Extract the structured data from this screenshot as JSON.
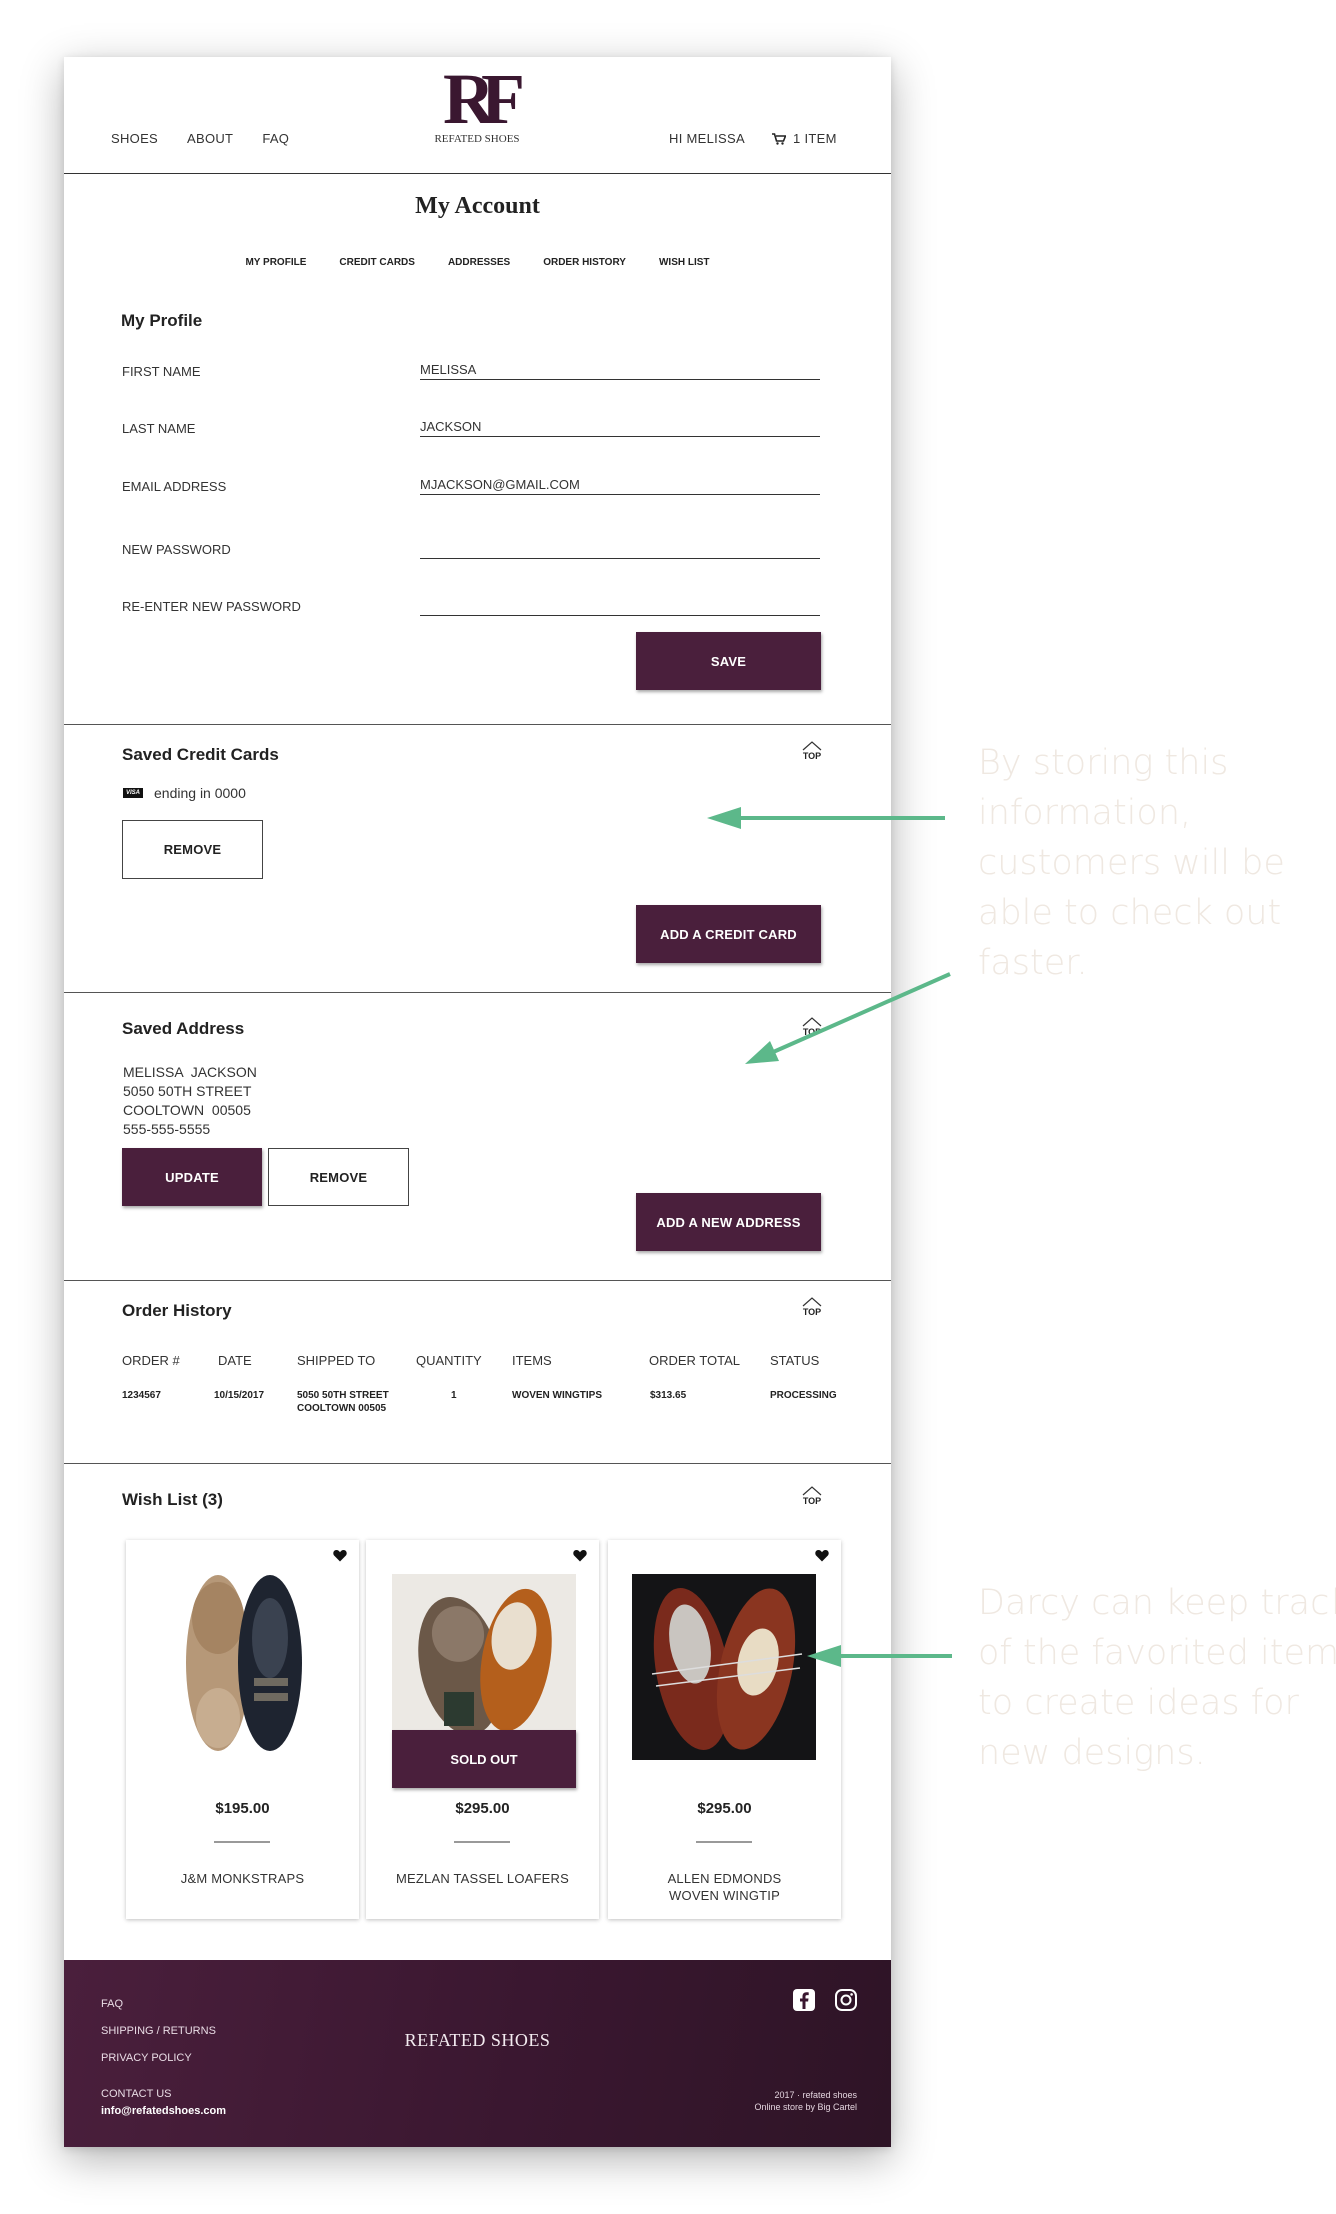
{
  "header": {
    "nav_left": [
      "SHOES",
      "ABOUT",
      "FAQ"
    ],
    "logo_mark": "RF",
    "logo_text": "REFATED SHOES",
    "greeting": "HI MELISSA",
    "cart_label": "1 ITEM"
  },
  "account": {
    "title": "My Account",
    "tabs": [
      "MY PROFILE",
      "CREDIT CARDS",
      "ADDRESSES",
      "ORDER HISTORY",
      "WISH LIST"
    ]
  },
  "profile": {
    "heading": "My Profile",
    "fields": [
      {
        "label": "FIRST NAME",
        "value": "MELISSA"
      },
      {
        "label": "LAST NAME",
        "value": "JACKSON"
      },
      {
        "label": "EMAIL ADDRESS",
        "value": "MJACKSON@GMAIL.COM"
      },
      {
        "label": "NEW PASSWORD",
        "value": ""
      },
      {
        "label": "RE-ENTER NEW PASSWORD",
        "value": ""
      }
    ],
    "save_label": "SAVE"
  },
  "top_label": "TOP",
  "cards": {
    "heading": "Saved Credit Cards",
    "card_brand": "VISA",
    "card_text": "ending in 0000",
    "remove_label": "REMOVE",
    "add_label": "ADD A CREDIT CARD"
  },
  "address": {
    "heading": "Saved Address",
    "lines": [
      "MELISSA  JACKSON",
      "5050 50TH STREET",
      "COOLTOWN  00505",
      "555-555-5555"
    ],
    "update_label": "UPDATE",
    "remove_label": "REMOVE",
    "add_label": "ADD A NEW ADDRESS"
  },
  "orders": {
    "heading": "Order History",
    "columns": [
      "ORDER #",
      "DATE",
      "SHIPPED TO",
      "QUANTITY",
      "ITEMS",
      "ORDER TOTAL",
      "STATUS"
    ],
    "rows": [
      {
        "order": "1234567",
        "date": "10/15/2017",
        "shipped_to": [
          "5050 50TH STREET",
          "COOLTOWN 00505"
        ],
        "quantity": "1",
        "items": "WOVEN WINGTIPS",
        "total": "$313.65",
        "status": "PROCESSING"
      }
    ]
  },
  "wishlist": {
    "heading": "Wish List (3)",
    "items": [
      {
        "price": "$195.00",
        "name": "J&M MONKSTRAPS",
        "sold_out": false
      },
      {
        "price": "$295.00",
        "name": "MEZLAN TASSEL LOAFERS",
        "sold_out": true,
        "sold_out_label": "SOLD OUT"
      },
      {
        "price": "$295.00",
        "name": "ALLEN EDMONDS\nWOVEN WINGTIP",
        "sold_out": false
      }
    ]
  },
  "footer": {
    "links": [
      "FAQ",
      "SHIPPING / RETURNS",
      "PRIVACY POLICY"
    ],
    "contact_label": "CONTACT US",
    "email": "info@refatedshoes.com",
    "brand": "REFATED SHOES",
    "copyright": "2017 · refated shoes",
    "credit": "Online store by Big Cartel"
  },
  "annotations": {
    "note1": "By storing this\ninformation,\ncustomers will be\nable to check out\nfaster.",
    "note2": "Darcy can keep track\nof the favorited items\nto create ideas for\nnew designs.",
    "arrow_color": "#5cb88a"
  },
  "colors": {
    "brand": "#4a1f3c",
    "footer": "#3a1730"
  }
}
